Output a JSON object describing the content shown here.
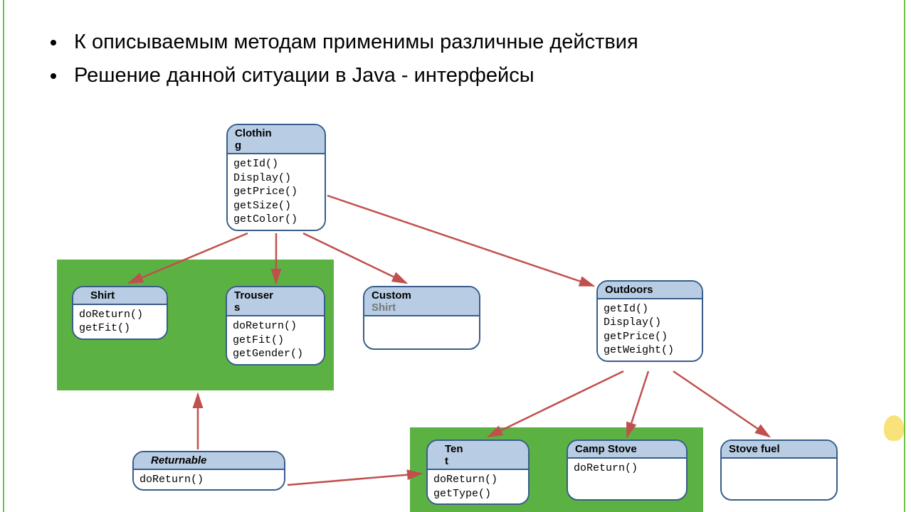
{
  "bullets": {
    "b1": "К описываемым методам применимы различные действия",
    "b2": "Решение данной ситуации в Java - интерфейсы"
  },
  "classes": {
    "clothing": {
      "name": "Clothin",
      "namewrap": "g",
      "methods": [
        "getId()",
        "Display()",
        "getPrice()",
        "getSize()",
        "getColor()"
      ]
    },
    "shirt": {
      "name": "Shirt",
      "methods": [
        "doReturn()",
        "getFit()"
      ]
    },
    "trousers": {
      "name": "Trouser",
      "namewrap": "s",
      "methods": [
        "doReturn()",
        "getFit()",
        "getGender()"
      ]
    },
    "custom": {
      "name": "Custom",
      "sub": "Shirt",
      "methods": []
    },
    "outdoors": {
      "name": "Outdoors",
      "methods": [
        "getId()",
        "Display()",
        "getPrice()",
        "getWeight()"
      ]
    },
    "tent": {
      "name": "Ten",
      "namewrap": "t",
      "methods": [
        "doReturn()",
        "getType()"
      ]
    },
    "campstove": {
      "name": "Camp Stove",
      "methods": [
        "doReturn()"
      ]
    },
    "stovefuel": {
      "name": "Stove fuel",
      "methods": []
    },
    "returnable": {
      "name": "Returnable",
      "methods": [
        "doReturn()"
      ]
    }
  },
  "colors": {
    "green": "#5bb242",
    "slideBorder": "#6fbf44",
    "boxBorder": "#385d8a",
    "boxHead": "#b8cde4",
    "arrow": "#c0504d"
  }
}
